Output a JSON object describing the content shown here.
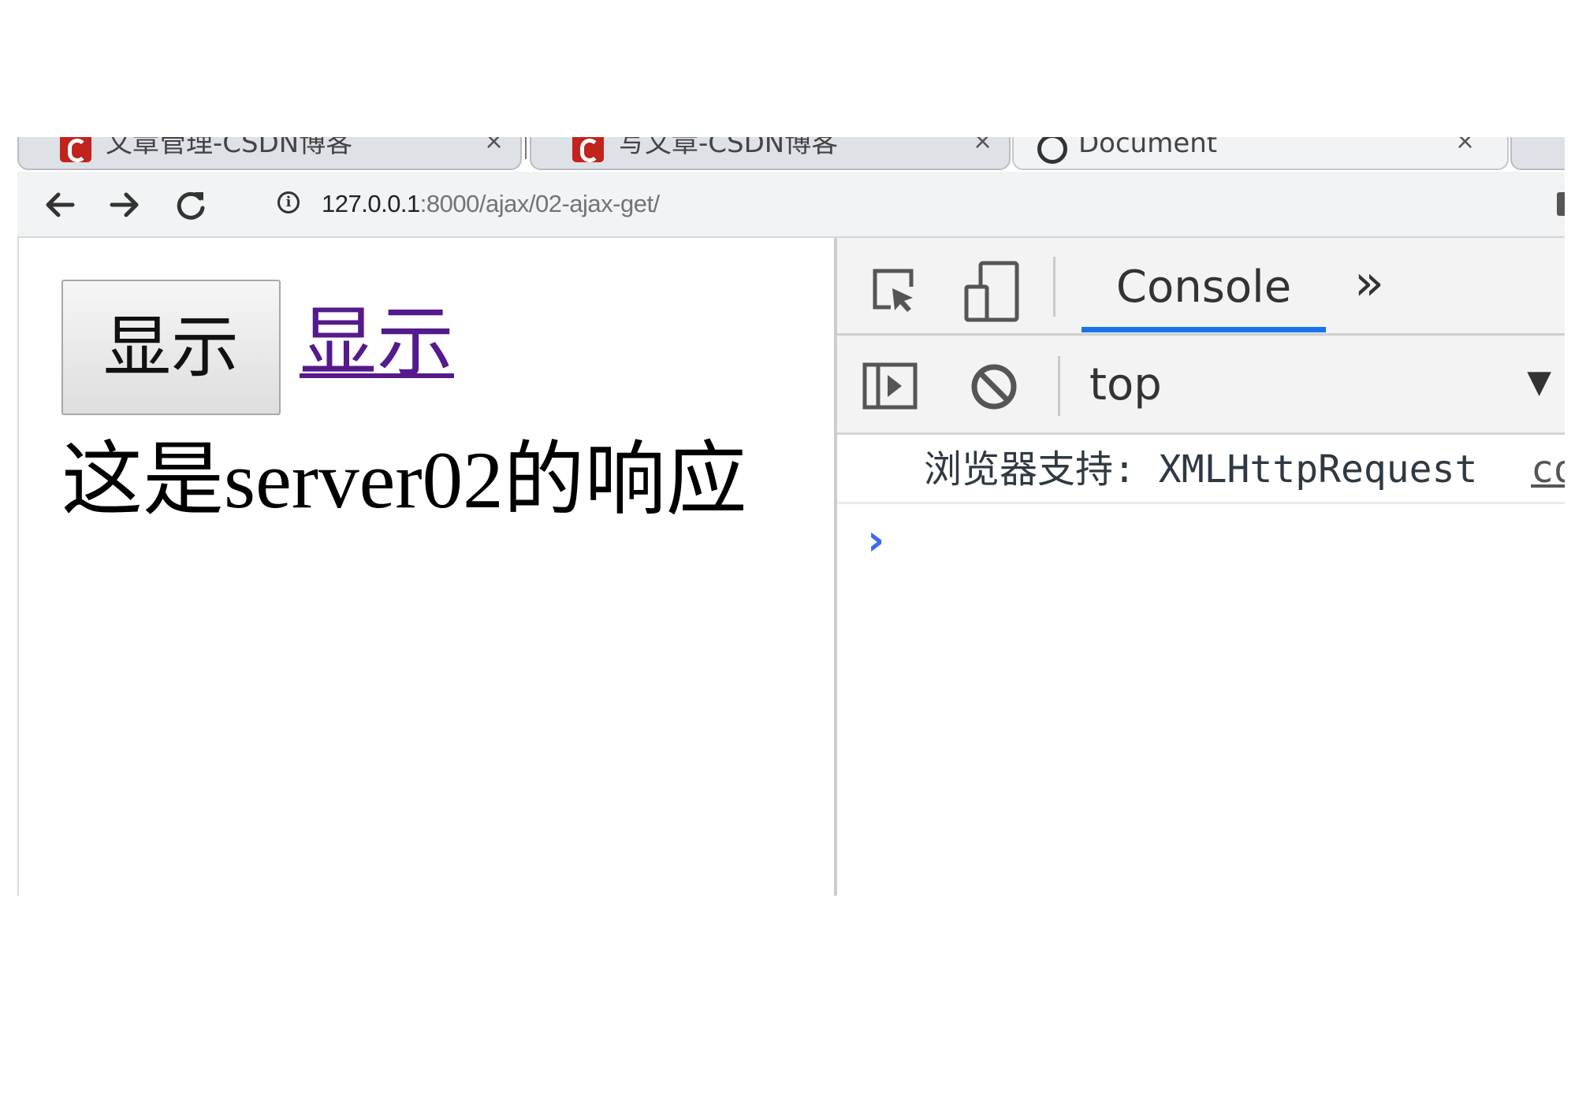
{
  "browser": {
    "tabs": [
      {
        "title": "文章管理-CSDN博客",
        "close": "×",
        "icon": "csdn-favicon",
        "active": false
      },
      {
        "title": "写文章-CSDN博客",
        "close": "×",
        "icon": "csdn-favicon",
        "active": false
      },
      {
        "title": "Document",
        "close": "×",
        "icon": "globe-icon",
        "active": true
      }
    ],
    "nav": {
      "back_icon": "←",
      "forward_icon": "→",
      "reload_icon": "reload-icon"
    },
    "address": {
      "info_icon": "i",
      "host": "127.0.0.1",
      "path": ":8000/ajax/02-ajax-get/"
    }
  },
  "page": {
    "button_label": "显示",
    "link_label": "显示",
    "response_text": "这是server02的响应",
    "link_color": "#551a8b"
  },
  "devtools": {
    "active_tab": "Console",
    "more_tabs_icon": "»",
    "context": {
      "value": "top",
      "arrow": "▼"
    },
    "console": {
      "messages": [
        {
          "text": "浏览器支持: XMLHttpRequest",
          "source": "co"
        }
      ],
      "prompt": "›",
      "accent_color": "#1a73e8"
    }
  }
}
